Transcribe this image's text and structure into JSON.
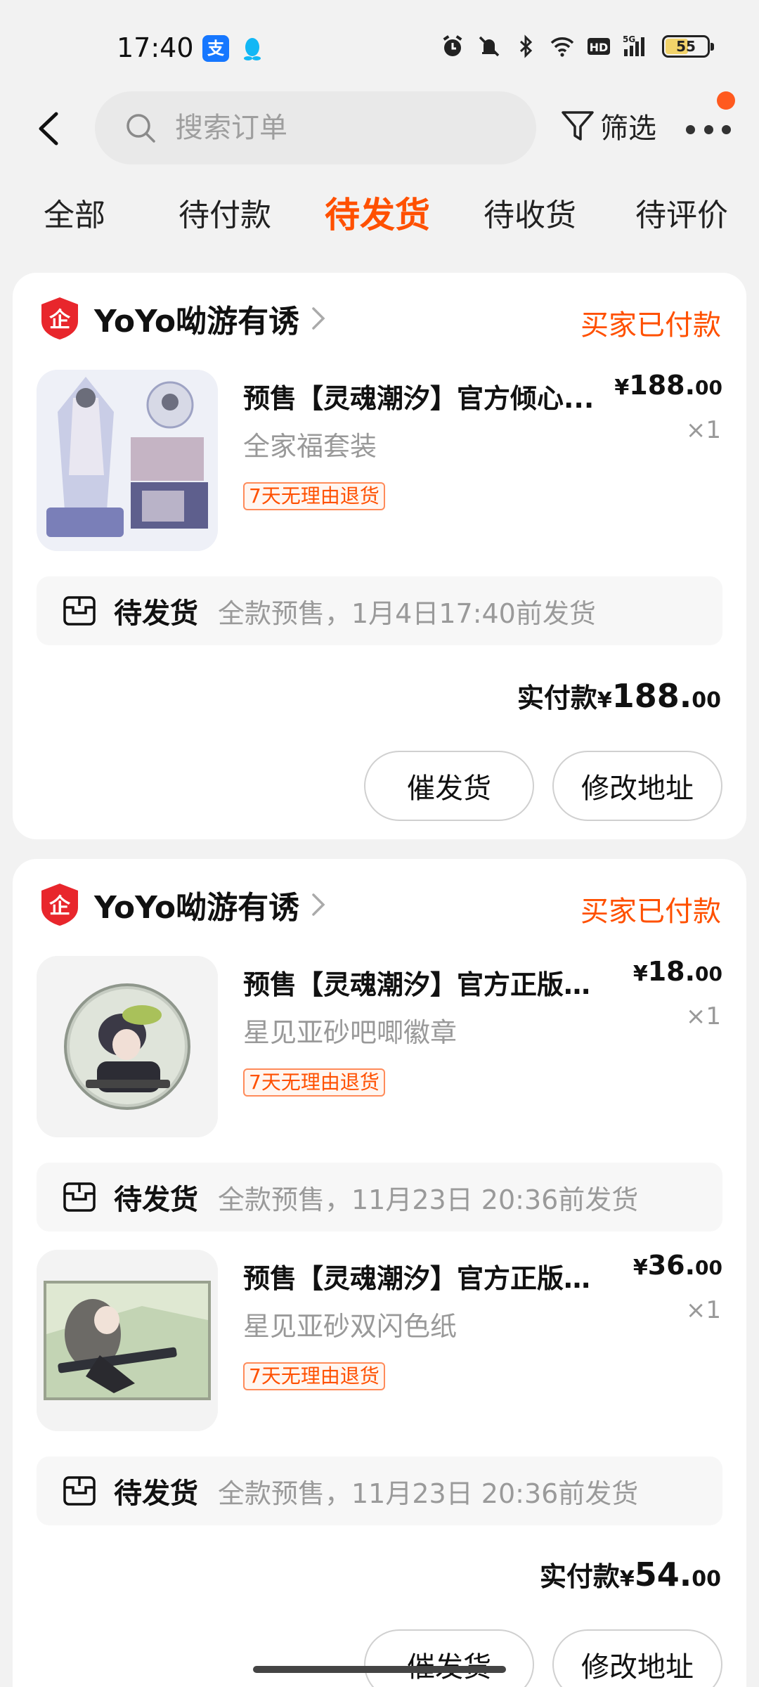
{
  "status_bar": {
    "time": "17:40",
    "battery": "55",
    "icons": [
      "alipay-icon",
      "qq-icon",
      "alarm-icon",
      "mute-icon",
      "bluetooth-icon",
      "wifi-icon",
      "hd-icon",
      "5g-signal-icon",
      "battery-icon"
    ]
  },
  "topbar": {
    "search_placeholder": "搜索订单",
    "filter_label": "筛选"
  },
  "tabs": [
    {
      "label": "全部",
      "active": false
    },
    {
      "label": "待付款",
      "active": false
    },
    {
      "label": "待发货",
      "active": true
    },
    {
      "label": "待收货",
      "active": false
    },
    {
      "label": "待评价",
      "active": false
    }
  ],
  "orders": [
    {
      "shop_name": "YoYo呦游有诱",
      "status": "买家已付款",
      "items": [
        {
          "title": "预售【灵魂潮汐】官方倾心...",
          "spec": "全家福套装",
          "badge": "7天无理由退货",
          "price_currency": "¥",
          "price_int": "188.",
          "price_dec": "00",
          "qty": "×1",
          "ship_title": "待发货",
          "ship_desc": "全款预售，1月4日17:40前发货"
        }
      ],
      "total_label": "实付款",
      "total_currency": "¥",
      "total_int": "188.",
      "total_dec": "00",
      "buttons": [
        "催发货",
        "修改地址"
      ]
    },
    {
      "shop_name": "YoYo呦游有诱",
      "status": "买家已付款",
      "items": [
        {
          "title": "预售【灵魂潮汐】官方正版角...",
          "spec": "星见亚砂吧唧徽章",
          "badge": "7天无理由退货",
          "price_currency": "¥",
          "price_int": "18.",
          "price_dec": "00",
          "qty": "×1",
          "ship_title": "待发货",
          "ship_desc": "全款预售，11月23日 20:36前发货"
        },
        {
          "title": "预售【灵魂潮汐】官方正版游...",
          "spec": "星见亚砂双闪色纸",
          "badge": "7天无理由退货",
          "price_currency": "¥",
          "price_int": "36.",
          "price_dec": "00",
          "qty": "×1",
          "ship_title": "待发货",
          "ship_desc": "全款预售，11月23日 20:36前发货"
        }
      ],
      "total_label": "实付款",
      "total_currency": "¥",
      "total_int": "54.",
      "total_dec": "00",
      "buttons": [
        "催发货",
        "修改地址"
      ]
    }
  ],
  "colors": {
    "accent": "#ff5000",
    "background": "#f2f2f2",
    "card": "#ffffff",
    "muted_text": "#999999"
  }
}
